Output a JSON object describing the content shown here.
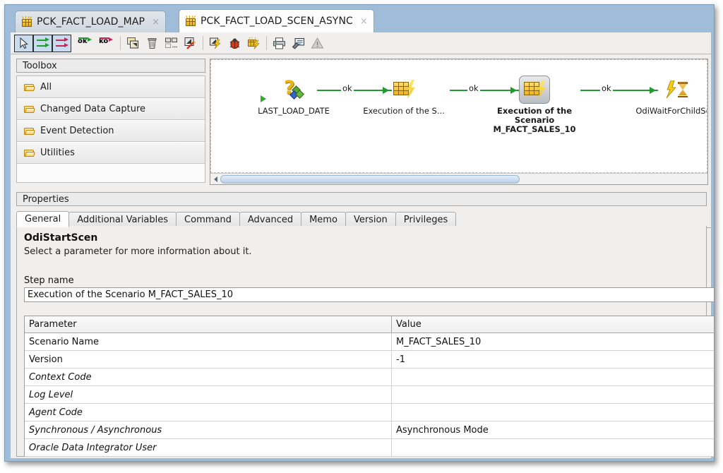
{
  "window": {
    "tabs": [
      {
        "label": "PCK_FACT_LOAD_MAP",
        "close": "×",
        "active": false
      },
      {
        "label": "PCK_FACT_LOAD_SCEN_ASYNC",
        "close": "×",
        "active": true
      }
    ]
  },
  "toolbar": {
    "buttons": [
      {
        "name": "select-tool",
        "label": "Select",
        "pressed": true
      },
      {
        "name": "next-step-on-success-tool",
        "label": "Next Step on Success",
        "pressed": true
      },
      {
        "name": "next-step-on-failure-tool",
        "label": "Next Step on Failure",
        "pressed": true
      },
      {
        "name": "ok-link-tool",
        "label": "ok"
      },
      {
        "name": "ko-link-tool",
        "label": "ko"
      },
      {
        "name": "duplicate-button",
        "label": "Duplicate"
      },
      {
        "name": "delete-button",
        "label": "Delete"
      },
      {
        "name": "arrange-button",
        "label": "Arrange"
      },
      {
        "name": "edit-button",
        "label": "Edit"
      },
      {
        "name": "execute-button",
        "label": "Execute"
      },
      {
        "name": "debug-button",
        "label": "Debug"
      },
      {
        "name": "generate-scenario-button",
        "label": "Generate Scenario"
      },
      {
        "name": "print-button",
        "label": "Print"
      },
      {
        "name": "properties-button",
        "label": "Properties"
      },
      {
        "name": "warning-button",
        "label": "Warnings"
      }
    ]
  },
  "toolbox": {
    "title": "Toolbox",
    "items": [
      {
        "label": "All"
      },
      {
        "label": "Changed Data Capture"
      },
      {
        "label": "Event Detection"
      },
      {
        "label": "Utilities"
      }
    ]
  },
  "diagram": {
    "nodes": [
      {
        "id": "last-load-date",
        "label": "LAST_LOAD_DATE",
        "type": "variable",
        "selected": false
      },
      {
        "id": "execution-of-the-s",
        "label": "Execution of the S...",
        "type": "scenario",
        "selected": false
      },
      {
        "id": "execution-of-the-scenario-m-fact-sales-10",
        "label": "Execution of the\nScenario\nM_FACT_SALES_10",
        "type": "scenario",
        "selected": true
      },
      {
        "id": "odi-wait-for-child-se",
        "label": "OdiWaitForChildSe...",
        "type": "wait",
        "selected": false
      }
    ],
    "links": [
      {
        "label": "ok"
      },
      {
        "label": "ok"
      },
      {
        "label": "ok"
      }
    ],
    "link_color": "#1f9b2f"
  },
  "properties": {
    "title": "Properties",
    "tabs": [
      {
        "label": "General",
        "active": true
      },
      {
        "label": "Additional Variables",
        "active": false
      },
      {
        "label": "Command",
        "active": false
      },
      {
        "label": "Advanced",
        "active": false
      },
      {
        "label": "Memo",
        "active": false
      },
      {
        "label": "Version",
        "active": false
      },
      {
        "label": "Privileges",
        "active": false
      }
    ],
    "heading": "OdiStartScen",
    "subheading": "Select a parameter for more information about it.",
    "step_name_label": "Step name",
    "step_name_value": "Execution of the Scenario M_FACT_SALES_10",
    "table": {
      "columns": [
        "Parameter",
        "Value"
      ],
      "rows": [
        {
          "parameter": "Scenario Name",
          "value": "M_FACT_SALES_10",
          "italic": false
        },
        {
          "parameter": "Version",
          "value": "-1",
          "italic": false
        },
        {
          "parameter": "Context Code",
          "value": "",
          "italic": true
        },
        {
          "parameter": "Log Level",
          "value": "",
          "italic": true
        },
        {
          "parameter": "Agent Code",
          "value": "",
          "italic": true
        },
        {
          "parameter": "Synchronous / Asynchronous",
          "value": "Asynchronous Mode",
          "italic": true
        },
        {
          "parameter": "Oracle Data Integrator User",
          "value": "",
          "italic": true
        }
      ]
    }
  },
  "colors": {
    "frame": "#9fbcd8",
    "link": "#1f9b2f",
    "accent_selected_tool": "#c9dcee"
  }
}
